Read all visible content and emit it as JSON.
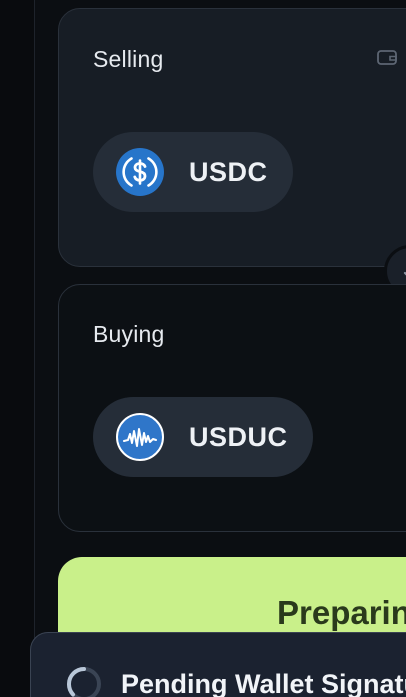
{
  "sell": {
    "label": "Selling",
    "token": {
      "symbol": "USDC",
      "icon": "usdc-logo-icon",
      "color": "#2775ca"
    },
    "balance_icon": "wallet-icon"
  },
  "buy": {
    "label": "Buying",
    "token": {
      "symbol": "USDUC",
      "icon": "usduc-logo-icon",
      "color": "#2f76c9"
    }
  },
  "swap_direction_icon": "arrow-swap-icon",
  "action_button": {
    "label": "Preparing Swap...",
    "color": "#c9f08a"
  },
  "toast": {
    "title": "Pending Wallet Signature",
    "icon": "spinner-icon"
  }
}
